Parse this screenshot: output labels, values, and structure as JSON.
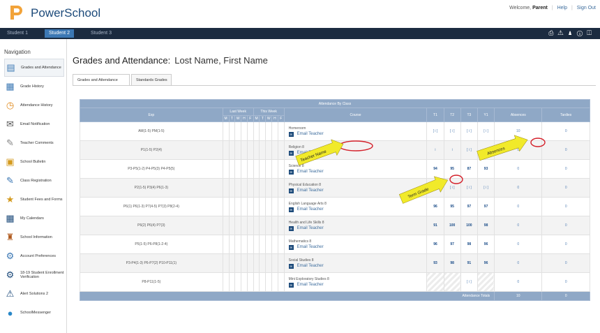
{
  "header": {
    "brand": "PowerSchool",
    "welcome": "Welcome,",
    "user": "Parent",
    "help": "Help",
    "signout": "Sign Out"
  },
  "student_tabs": [
    "Student 1",
    "Student 2",
    "Student 3"
  ],
  "active_student": 1,
  "sidebar": {
    "title": "Navigation",
    "items": [
      {
        "label": "Grades and Attendance",
        "icon": "grades-icon"
      },
      {
        "label": "Grade History",
        "icon": "grade-history-icon"
      },
      {
        "label": "Attendance History",
        "icon": "attendance-history-icon"
      },
      {
        "label": "Email Notification",
        "icon": "email-icon"
      },
      {
        "label": "Teacher Comments",
        "icon": "comments-icon"
      },
      {
        "label": "School Bulletin",
        "icon": "bulletin-icon"
      },
      {
        "label": "Class Registration",
        "icon": "registration-icon"
      },
      {
        "label": "Student Fees and Forms",
        "icon": "fees-icon"
      },
      {
        "label": "My Calendars",
        "icon": "calendar-icon"
      },
      {
        "label": "School Information",
        "icon": "school-icon"
      },
      {
        "label": "Account Preferences",
        "icon": "preferences-icon"
      },
      {
        "label": "18-19 Student Enrollment Verification",
        "icon": "enrollment-icon"
      },
      {
        "label": "Alert Solutions 2",
        "icon": "alert-icon"
      },
      {
        "label": "SchoolMessenger",
        "icon": "messenger-icon"
      }
    ]
  },
  "main": {
    "title": "Grades and Attendance:",
    "student_name": "Lost Name, First Name",
    "tabs": [
      "Grades and Attendance",
      "Standards Grades"
    ],
    "table_title": "Attendance By Class",
    "headers": {
      "exp": "Exp",
      "last_week": "Last Week",
      "this_week": "This Week",
      "days": [
        "M",
        "T",
        "W",
        "H",
        "F",
        "M",
        "T",
        "W",
        "H",
        "F"
      ],
      "course": "Course",
      "t1": "T1",
      "t2": "T2",
      "t3": "T3",
      "y1": "Y1",
      "absences": "Absences",
      "tardies": "Tardies"
    },
    "email_label": "Email Teacher",
    "rows": [
      {
        "exp": "AM(1-5) PM(1-5)",
        "course": "Homeroom",
        "t1": "[ i ]",
        "t2": "[ i ]",
        "t3": "[ i ]",
        "y1": "[ i ]",
        "abs": "10",
        "tar": "0",
        "hatch": false
      },
      {
        "exp": "P1(1-5) P2(4)",
        "course": "Religion 8",
        "t1": "i",
        "t2": "i",
        "t3": "[ i ]",
        "y1": "i",
        "abs": "0",
        "tar": "0",
        "hatch": false
      },
      {
        "exp": "P3-P5(1-2) P4-P5(3) P4-P5(5)",
        "course": "Science 8",
        "t1": "94",
        "t2": "95",
        "t3": "87",
        "y1": "93",
        "abs": "0",
        "tar": "0",
        "hatch": false
      },
      {
        "exp": "P2(1-5) P3(4) P6(1-3)",
        "course": "Physical Education 8",
        "t1": "[ i ]",
        "t2": "[ i ]",
        "t3": "[ i ]",
        "y1": "[ i ]",
        "abs": "0",
        "tar": "0",
        "hatch": false
      },
      {
        "exp": "P6(1) P6(1-3) P7(4-5) P7(3) P8(2-4)",
        "course": "English Language Arts 8",
        "t1": "96",
        "t2": "95",
        "t3": "97",
        "y1": "97",
        "abs": "0",
        "tar": "0",
        "hatch": false
      },
      {
        "exp": "P6(2) P6(4) P7(3)",
        "course": "Health and Life Skills 8",
        "t1": "91",
        "t2": "100",
        "t3": "100",
        "y1": "98",
        "abs": "0",
        "tar": "0",
        "hatch": false
      },
      {
        "exp": "P5(1-5) P6-P8(1-2-4)",
        "course": "Mathematics 8",
        "t1": "96",
        "t2": "97",
        "t3": "98",
        "y1": "96",
        "abs": "0",
        "tar": "0",
        "hatch": false
      },
      {
        "exp": "P3-P4(1-3) P6-P7(2) P10-P11(1)",
        "course": "Social Studies 8",
        "t1": "93",
        "t2": "98",
        "t3": "91",
        "y1": "96",
        "abs": "0",
        "tar": "0",
        "hatch": false
      },
      {
        "exp": "P8-P11(1-5)",
        "course": "Mini Exploratory Studies 8",
        "t1": "",
        "t2": "",
        "t3": "[ i ]",
        "y1": "",
        "abs": "0",
        "tar": "0",
        "hatch": true
      }
    ],
    "totals": {
      "label": "Attendance Totals",
      "abs": "10",
      "tar": "0"
    }
  },
  "annotations": {
    "teacher_name": "Teacher Name",
    "absences": "Absences",
    "term_grade": "Term Grade",
    "color": "#f1ea2a",
    "circle_color": "#d4202a"
  },
  "colors": {
    "brand": "#1c4a7a",
    "tabbar": "#1b2b40",
    "active_tab": "#3c78b4",
    "table_header": "#8fa8c6"
  }
}
